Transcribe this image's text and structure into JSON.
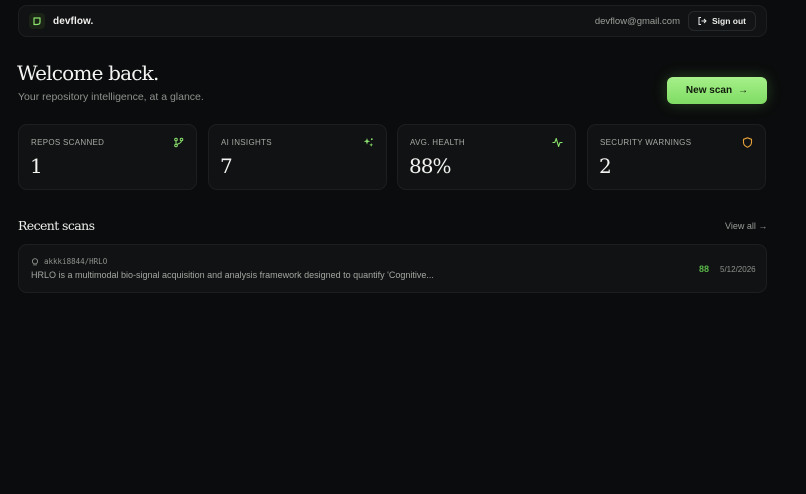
{
  "header": {
    "brand": "devflow.",
    "email": "devflow@gmail.com",
    "sign_out": "Sign out"
  },
  "hero": {
    "title": "Welcome back.",
    "subtitle": "Your repository intelligence, at a glance.",
    "new_scan": "New scan",
    "new_scan_arrow": "→"
  },
  "stats": [
    {
      "label": "REPOS SCANNED",
      "value": "1",
      "icon": "git-branch-icon"
    },
    {
      "label": "AI INSIGHTS",
      "value": "7",
      "icon": "sparkles-icon"
    },
    {
      "label": "AVG. HEALTH",
      "value": "88%",
      "icon": "activity-icon"
    },
    {
      "label": "SECURITY WARNINGS",
      "value": "2",
      "icon": "shield-icon"
    }
  ],
  "recent": {
    "title": "Recent scans",
    "view_all": "View all →",
    "items": [
      {
        "repo": "akkki8844/HRLO",
        "description": "HRLO is a multimodal bio-signal acquisition and analysis framework designed to quantify 'Cognitive...",
        "score": "88",
        "date": "5/12/2026"
      }
    ]
  },
  "colors": {
    "background": "#0b0c0d",
    "card": "#111213",
    "accent": "#8be46d",
    "warning": "#e6a13a"
  }
}
